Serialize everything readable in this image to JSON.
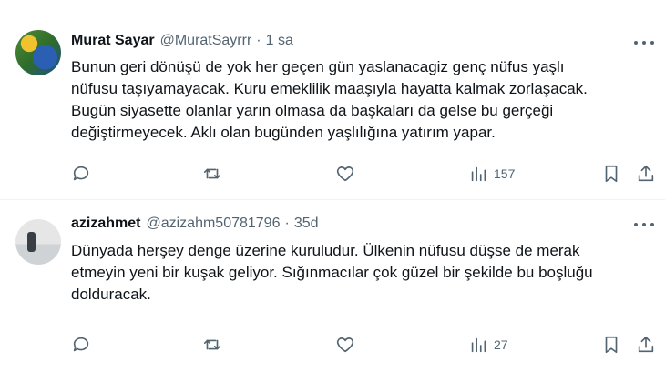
{
  "tweets": [
    {
      "name": "Murat Sayar",
      "handle": "@MuratSayrrr",
      "separator": "·",
      "time": "1 sa",
      "text": "Bunun geri dönüşü de yok her geçen gün yaslanacagiz genç nüfus yaşlı\nnüfusu taşıyamayacak. Kuru emeklilik maaşıyla hayatta kalmak zorlaşacak.\nBugün siyasette olanlar yarın olmasa da başkaları da gelse bu gerçeği\ndeğiştirmeyecek. Aklı olan bugünden yaşlılığına yatırım yapar.",
      "views": "157"
    },
    {
      "name": "azizahmet",
      "handle": "@azizahm50781796",
      "separator": "·",
      "time": "35d",
      "text": "Dünyada herşey denge üzerine kuruludur. Ülkenin nüfusu düşse de merak\netmeyin yeni bir kuşak geliyor. Sığınmacılar çok güzel bir şekilde bu boşluğu\ndolduracak.",
      "views": "27"
    }
  ],
  "icons": {
    "reply": "reply-icon",
    "retweet": "retweet-icon",
    "like": "heart-icon",
    "views": "views-icon",
    "bookmark": "bookmark-icon",
    "share": "share-icon",
    "more": "more-icon"
  },
  "colors": {
    "text": "#0f1419",
    "secondary": "#536471",
    "divider": "#eff3f4"
  }
}
